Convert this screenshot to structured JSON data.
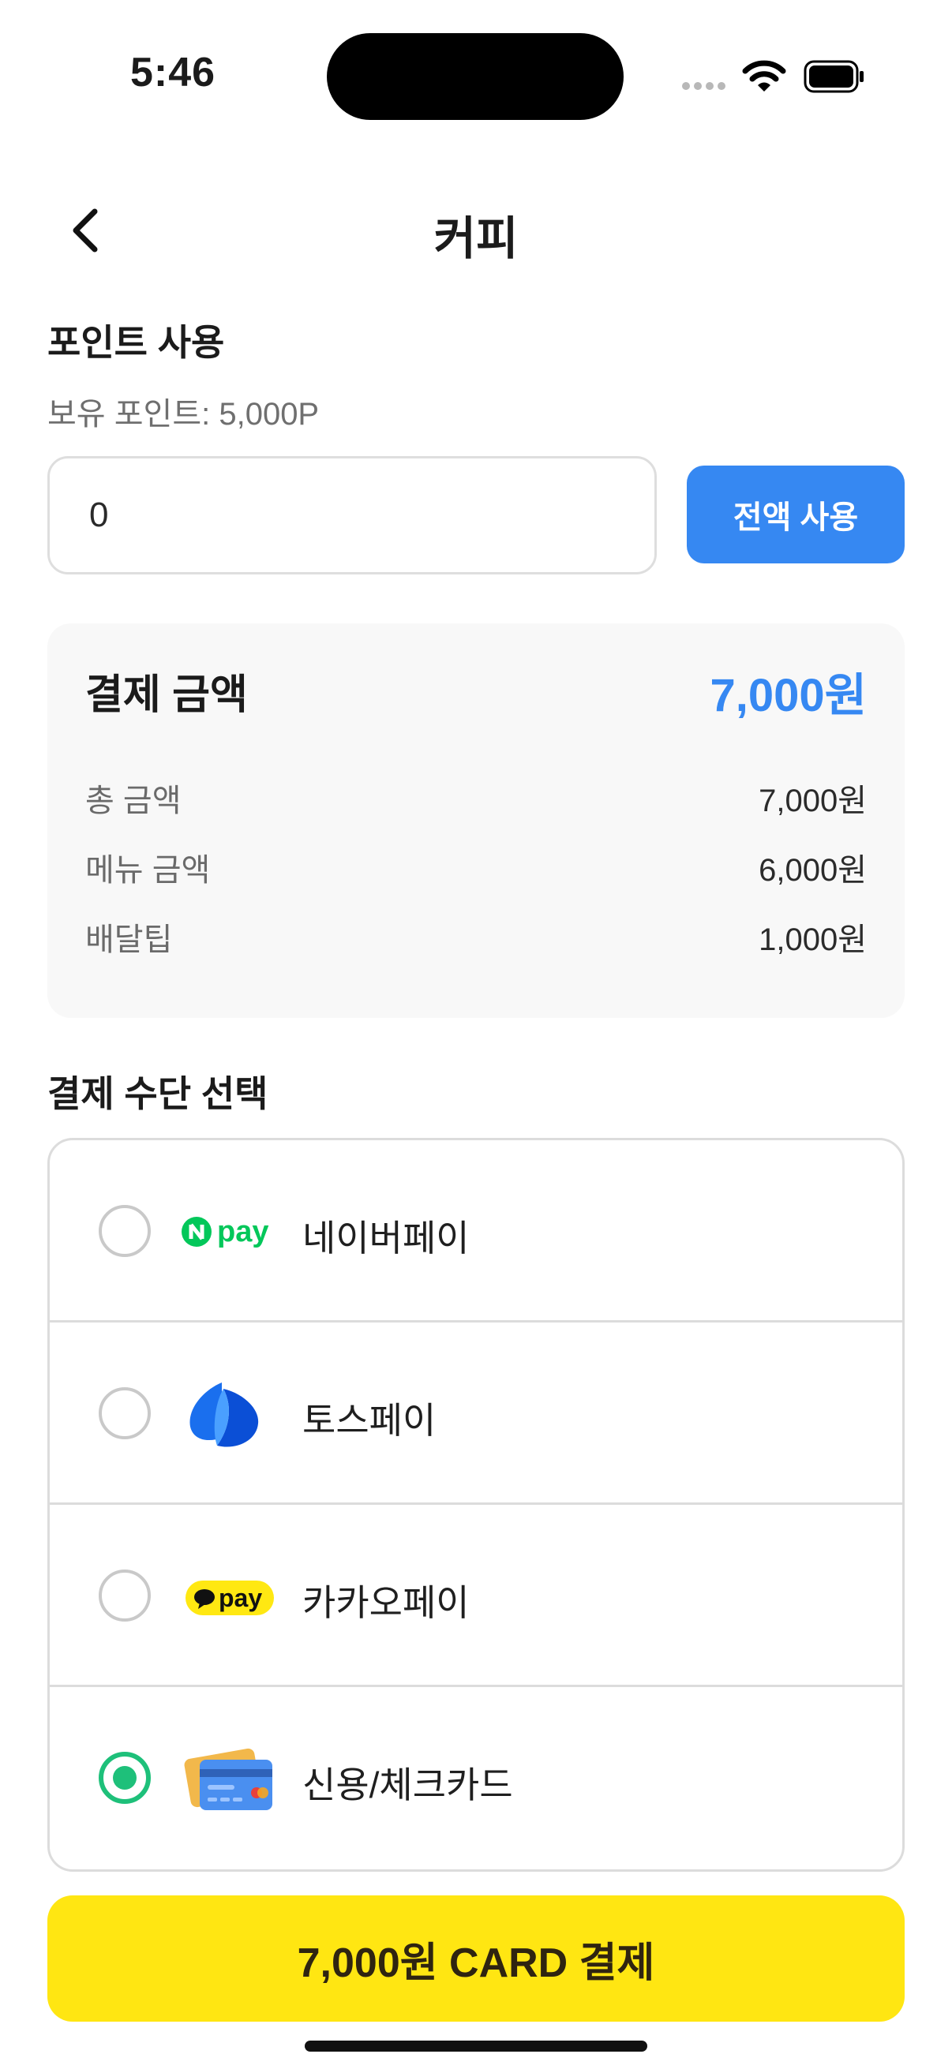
{
  "status": {
    "time": "5:46"
  },
  "header": {
    "title": "커피"
  },
  "points": {
    "title": "포인트 사용",
    "balance": "보유 포인트: 5,000P",
    "input_value": "0",
    "use_all_label": "전액 사용"
  },
  "summary": {
    "label": "결제 금액",
    "amount": "7,000원",
    "rows": [
      {
        "label": "총 금액",
        "value": "7,000원"
      },
      {
        "label": "메뉴 금액",
        "value": "6,000원"
      },
      {
        "label": "배달팁",
        "value": "1,000원"
      }
    ]
  },
  "methods": {
    "title": "결제 수단 선택",
    "items": [
      {
        "label": "네이버페이",
        "icon": "naver-pay-logo",
        "selected": false
      },
      {
        "label": "토스페이",
        "icon": "toss-pay-logo",
        "selected": false
      },
      {
        "label": "카카오페이",
        "icon": "kakao-pay-logo",
        "selected": false
      },
      {
        "label": "신용/체크카드",
        "icon": "credit-card-icon",
        "selected": true
      }
    ],
    "naver_logo_text": "pay",
    "kakao_logo_text": "pay"
  },
  "pay_button": {
    "label": "7,000원 CARD 결제"
  },
  "colors": {
    "accent_blue": "#3688f2",
    "selected_green": "#1ec07a",
    "pay_yellow": "#ffe612"
  }
}
